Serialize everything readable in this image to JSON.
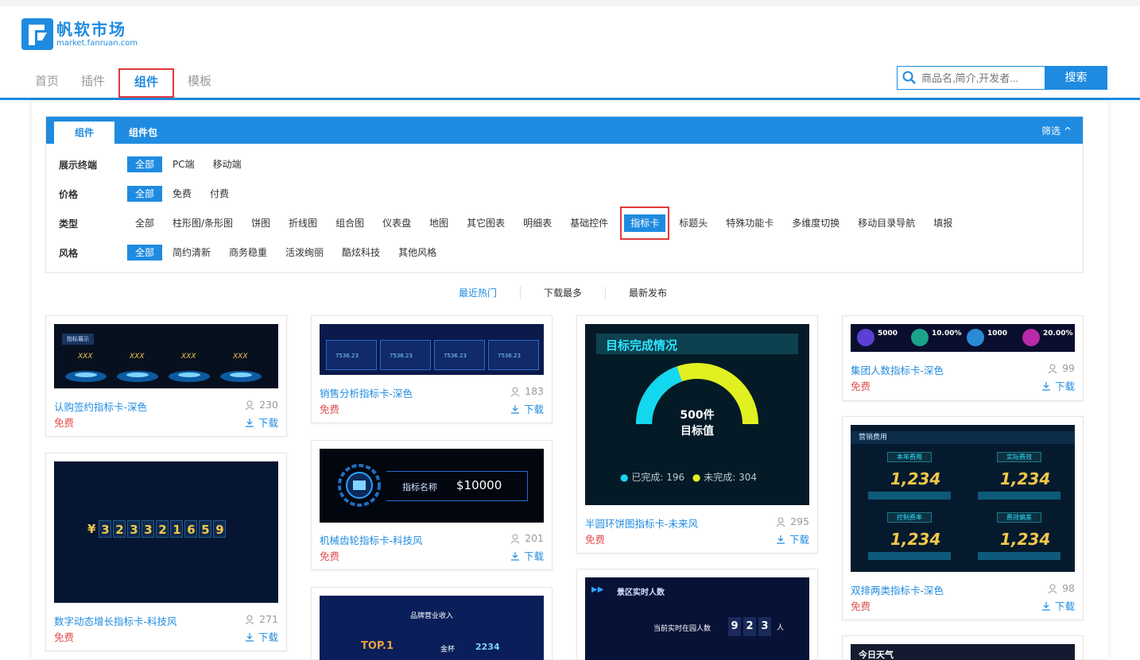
{
  "header": {
    "logo_title": "帆软市场",
    "logo_sub": "market.fanruan.com",
    "nav": [
      "首页",
      "插件",
      "组件",
      "模板"
    ],
    "search_placeholder": "商品名,简介,开发者...",
    "search_button": "搜索"
  },
  "filter": {
    "tabs": [
      "组件",
      "组件包"
    ],
    "toggle": "筛选",
    "rows": [
      {
        "label": "展示终端",
        "options": [
          "全部",
          "PC端",
          "移动端"
        ]
      },
      {
        "label": "价格",
        "options": [
          "全部",
          "免费",
          "付费"
        ]
      },
      {
        "label": "类型",
        "options": [
          "全部",
          "柱形图/条形图",
          "饼图",
          "折线图",
          "组合图",
          "仪表盘",
          "地图",
          "其它图表",
          "明细表",
          "基础控件",
          "指标卡",
          "标题头",
          "特殊功能卡",
          "多维度切换",
          "移动目录导航",
          "填报"
        ]
      },
      {
        "label": "风格",
        "options": [
          "全部",
          "简约清新",
          "商务稳重",
          "活泼绚丽",
          "酷炫科技",
          "其他风格"
        ]
      }
    ]
  },
  "sort": [
    "最近热门",
    "下载最多",
    "最新发布"
  ],
  "cards": [
    {
      "title": "认购签约指标卡-深色",
      "price": "免费",
      "users": "230",
      "download": "下载",
      "thumb": {
        "label": "指标展示",
        "items": [
          "XXX",
          "XXX",
          "XXX",
          "XXX"
        ]
      }
    },
    {
      "title": "销售分析指标卡-深色",
      "price": "免费",
      "users": "183",
      "download": "下载",
      "thumb": {
        "value": "7536.23"
      }
    },
    {
      "title": "半圆环饼图指标卡-未来风",
      "price": "免费",
      "users": "295",
      "download": "下载",
      "thumb": {
        "heading": "目标完成情况",
        "center_value": "500件",
        "center_label": "目标值",
        "done_label": "已完成:",
        "done_value": "196",
        "todo_label": "未完成:",
        "todo_value": "304",
        "done_ratio": 0.392
      }
    },
    {
      "title": "集团人数指标卡-深色",
      "price": "免费",
      "users": "99",
      "download": "下载",
      "thumb": {
        "values": [
          "5000",
          "10.00%",
          "1000",
          "20.00%"
        ]
      }
    },
    {
      "title": "数字动态增长指标卡-科技风",
      "price": "免费",
      "users": "271",
      "download": "下载",
      "thumb": {
        "currency": "¥",
        "digits": [
          "3",
          "2",
          "3",
          "3",
          "2",
          "1",
          "6",
          "5",
          "9"
        ]
      }
    },
    {
      "title": "机械齿轮指标卡-科技风",
      "price": "免费",
      "users": "201",
      "download": "下载",
      "thumb": {
        "label": "指标名称",
        "value": "$10000"
      }
    },
    {
      "title": "双排两类指标卡-深色",
      "price": "免费",
      "users": "98",
      "download": "下载",
      "thumb": {
        "heading": "营销费用",
        "labels": [
          "本年费用",
          "实际费效",
          "控制费率",
          "费效偏差"
        ],
        "value": "1,234"
      }
    },
    {
      "thumb": {
        "heading": "品牌营业收入",
        "top": "TOP.1",
        "medal": "金杯",
        "value": "2234"
      }
    },
    {
      "thumb": {
        "heading": "景区实时人数",
        "label": "当前实时在园人数",
        "digits": [
          "9",
          "2",
          "3"
        ],
        "unit": "人"
      }
    },
    {
      "thumb": {
        "heading": "今日天气"
      }
    }
  ],
  "colors": {
    "accent": "#1f8be0",
    "price": "#e05050",
    "highlight": "#e23a3a"
  }
}
